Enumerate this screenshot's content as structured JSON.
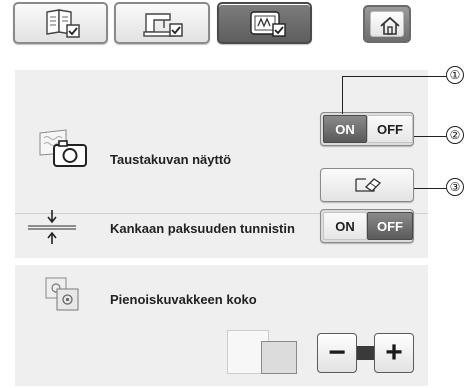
{
  "tabs": [
    {
      "name": "tab-general-settings-icon",
      "active": false
    },
    {
      "name": "tab-sewing-settings-icon",
      "active": false
    },
    {
      "name": "tab-embroidery-settings-icon",
      "active": true
    }
  ],
  "home_icon": "home-icon",
  "callouts": [
    "①",
    "②",
    "③"
  ],
  "background_display": {
    "label": "Taustakuvan näyttö",
    "icon": "camera-icon",
    "on_label": "ON",
    "off_label": "OFF",
    "selected": "ON",
    "erase_icon": "eraser-icon"
  },
  "fabric_thickness": {
    "label": "Kankaan paksuuden tunnistin",
    "icon": "fabric-thickness-icon",
    "on_label": "ON",
    "off_label": "OFF",
    "selected": "OFF"
  },
  "thumbnail_size": {
    "label": "Pienoiskuvakkeen koko",
    "icon": "thumbnail-icon",
    "minus_label": "−",
    "plus_label": "+"
  }
}
